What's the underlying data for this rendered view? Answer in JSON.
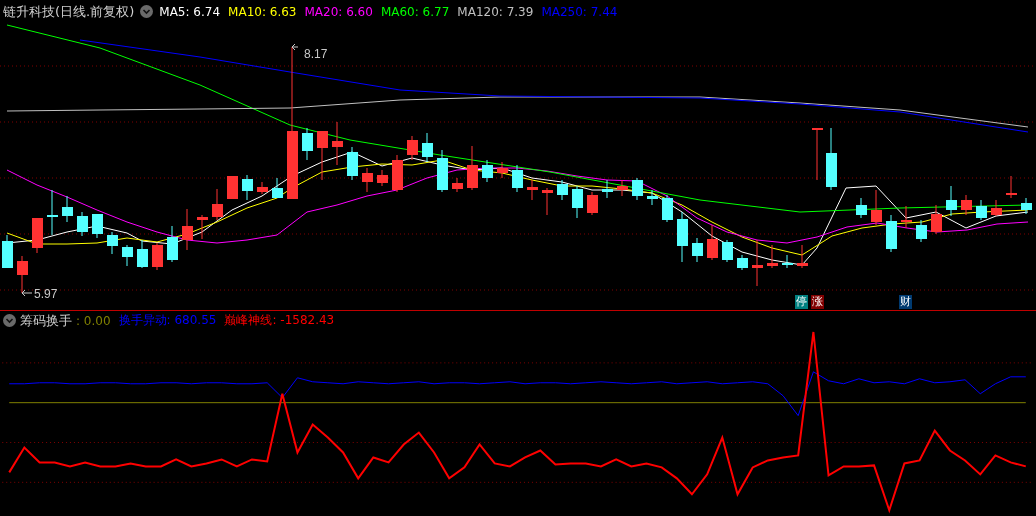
{
  "main_panel": {
    "title": "链升科技(日线.前复权)",
    "moving_averages": [
      {
        "text": "MA5: 6.74",
        "color": "#ffffff"
      },
      {
        "text": "MA10: 6.63",
        "color": "#ffff00"
      },
      {
        "text": "MA20: 6.60",
        "color": "#ff00ff"
      },
      {
        "text": "MA60: 6.77",
        "color": "#00ff00"
      },
      {
        "text": "MA120: 7.39",
        "color": "#c0c0c0"
      },
      {
        "text": "MA250: 7.44",
        "color": "#0000ff"
      }
    ],
    "high_label": "8.17",
    "low_label": "5.97",
    "event_markers": [
      {
        "text": "停",
        "color": "#008080"
      },
      {
        "text": "涨",
        "color": "#800000"
      },
      {
        "text": "财",
        "color": "#003a70"
      }
    ]
  },
  "indicator_panel": {
    "title": "筹码换手",
    "values": [
      {
        "text": ": 0.00",
        "color": "#808000"
      },
      {
        "text": "换手异动: 680.55",
        "color": "#0000ff"
      },
      {
        "text": "巅峰神线: -1582.43",
        "color": "#ff0000"
      }
    ]
  }
}
